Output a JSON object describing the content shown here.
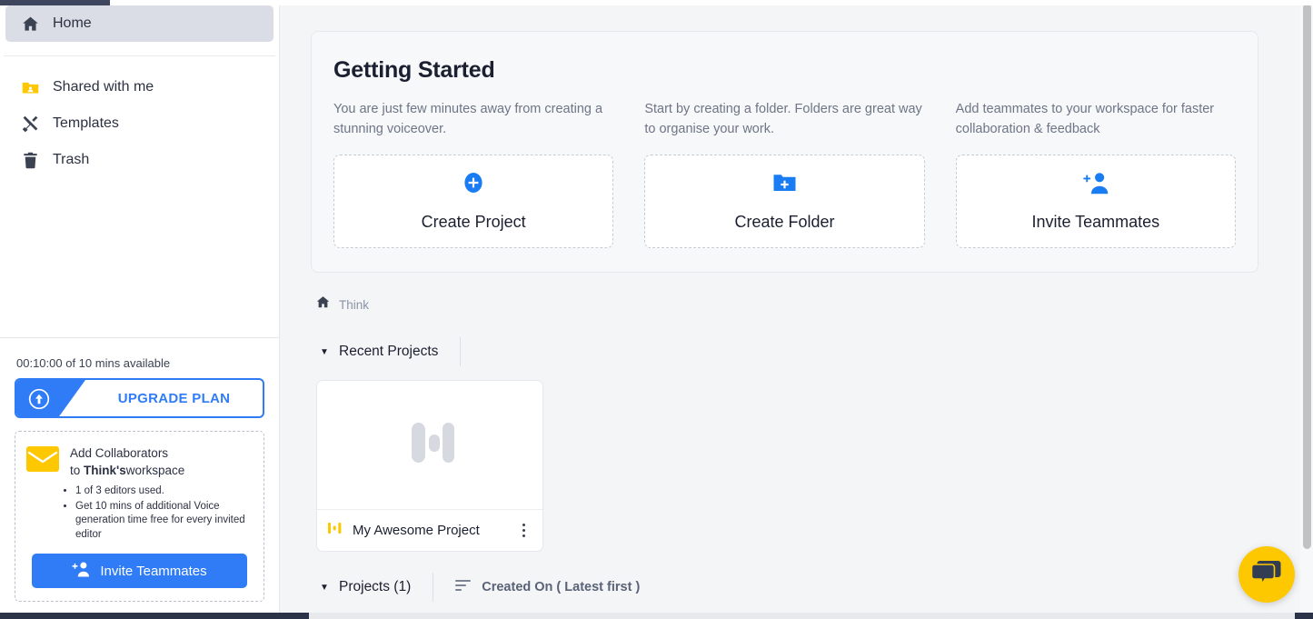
{
  "sidebar": {
    "nav": [
      {
        "label": "Home",
        "icon": "home-icon",
        "active": true
      },
      {
        "label": "Shared with me",
        "icon": "folder-shared-icon",
        "active": false
      },
      {
        "label": "Templates",
        "icon": "templates-icon",
        "active": false
      },
      {
        "label": "Trash",
        "icon": "trash-icon",
        "active": false
      }
    ],
    "quota_text": "00:10:00 of 10 mins available",
    "upgrade_label": "UPGRADE PLAN",
    "upgrade_icon": "arrow-up-circle-icon",
    "collaborators": {
      "mail_icon": "envelope-icon",
      "line1": "Add Collaborators",
      "line2_prefix": "to ",
      "line2_bold": "Think's",
      "line2_suffix": "workspace",
      "bullets": [
        "1 of 3 editors used.",
        "Get 10 mins of additional Voice generation time free for every invited editor"
      ],
      "invite_label": "Invite Teammates",
      "invite_icon": "person-add-icon"
    }
  },
  "main": {
    "getting_started": {
      "title": "Getting Started",
      "columns": [
        {
          "description": "You are just few minutes away from creating a stunning voiceover.",
          "action_label": "Create Project",
          "action_icon": "plus-circle-icon"
        },
        {
          "description": "Start by creating a folder. Folders are great way to organise your work.",
          "action_label": "Create Folder",
          "action_icon": "folder-plus-icon"
        },
        {
          "description": "Add teammates to your workspace for faster collaboration & feedback",
          "action_label": "Invite Teammates",
          "action_icon": "person-add-icon"
        }
      ]
    },
    "breadcrumb": {
      "icon": "home-icon",
      "label": "Think"
    },
    "recent_section": {
      "caret_icon": "caret-down-icon",
      "title": "Recent Projects"
    },
    "projects": [
      {
        "name": "My Awesome Project",
        "thumb_icon": "waveform-icon",
        "badge_icon": "waveform-icon",
        "menu_icon": "kebab-menu-icon"
      }
    ],
    "projects_section": {
      "caret_icon": "caret-down-icon",
      "title": "Projects (1)",
      "sort_icon": "sort-icon",
      "sort_label": "Created On ( Latest first )"
    }
  },
  "chat": {
    "icon": "chat-bubbles-icon"
  },
  "colors": {
    "accent_blue": "#2f7cf6",
    "yellow": "#fdc800",
    "dark_navy": "#2b3348",
    "text_dark": "#1b2030",
    "text_muted": "#6d7586",
    "page_bg": "#f4f5f7"
  }
}
